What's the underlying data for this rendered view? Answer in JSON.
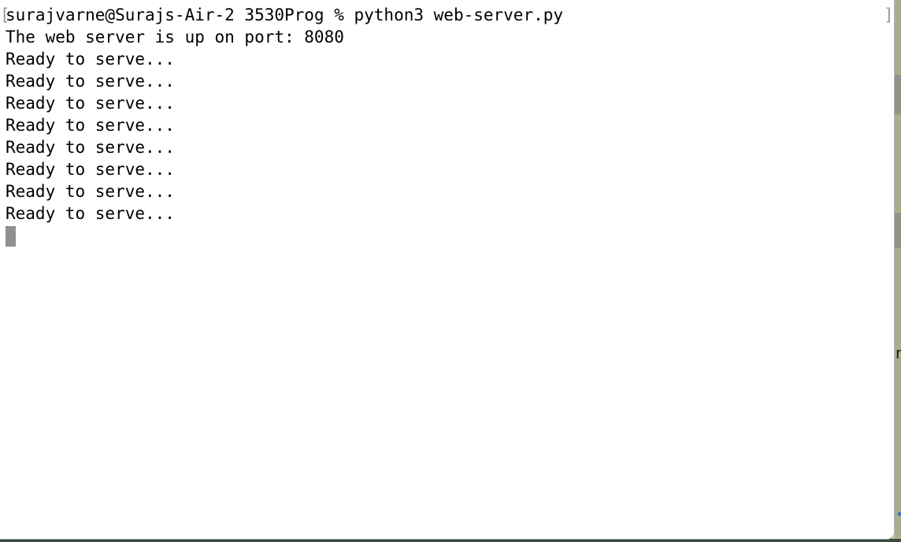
{
  "terminal": {
    "lines": [
      "surajvarne@Surajs-Air-2 3530Prog % python3 web-server.py",
      "The web server is up on port: 8080",
      "Ready to serve...",
      "Ready to serve...",
      "Ready to serve...",
      "Ready to serve...",
      "Ready to serve...",
      "Ready to serve...",
      "Ready to serve...",
      "Ready to serve..."
    ],
    "bracket_left": "[",
    "bracket_right": "]"
  },
  "backdrop": {
    "partial_glyph": "n"
  }
}
